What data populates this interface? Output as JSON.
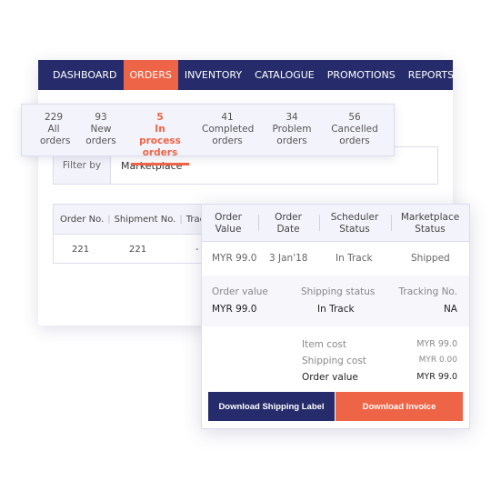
{
  "nav": {
    "items": [
      {
        "label": "DASHBOARD",
        "active": false
      },
      {
        "label": "ORDERS",
        "active": true
      },
      {
        "label": "INVENTORY",
        "active": false
      },
      {
        "label": "CATALOGUE",
        "active": false
      },
      {
        "label": "PROMOTIONS",
        "active": false
      },
      {
        "label": "REPORTS",
        "active": false
      }
    ]
  },
  "stats": [
    {
      "count": "229",
      "line1": "All",
      "line2": "orders"
    },
    {
      "count": "93",
      "line1": "New",
      "line2": "orders"
    },
    {
      "count": "5",
      "line1": "In process",
      "line2": "orders"
    },
    {
      "count": "41",
      "line1": "Completed",
      "line2": "orders"
    },
    {
      "count": "34",
      "line1": "Problem",
      "line2": "orders"
    },
    {
      "count": "56",
      "line1": "Cancelled",
      "line2": "orders"
    }
  ],
  "filter": {
    "label": "Filter by",
    "value": "Marketplace"
  },
  "table": {
    "headers": [
      "Order No.",
      "Shipment No.",
      "Trac"
    ],
    "rows": [
      {
        "order_no": "221",
        "shipment_no": "221",
        "tracking": "-"
      }
    ]
  },
  "popup": {
    "headers": [
      {
        "l1": "Order",
        "l2": "Value"
      },
      {
        "l1": "Order",
        "l2": "Date"
      },
      {
        "l1": "Scheduler",
        "l2": "Status"
      },
      {
        "l1": "Marketplace",
        "l2": "Status"
      }
    ],
    "row": {
      "order_value": "MYR 99.0",
      "order_date": "3 Jan'18",
      "scheduler_status": "In Track",
      "marketplace_status": "Shipped"
    },
    "details": {
      "order_value_label": "Order value",
      "order_value": "MYR 99.0",
      "shipping_status_label": "Shipping status",
      "shipping_status": "In Track",
      "tracking_label": "Tracking No.",
      "tracking": "NA"
    },
    "costs": {
      "item_cost_label": "Item cost",
      "item_cost": "MYR 99.0",
      "shipping_cost_label": "Shipping cost",
      "shipping_cost": "MYR 0.00",
      "order_value_label": "Order value",
      "order_value": "MYR 99.0"
    },
    "buttons": {
      "shipping_label": "Download Shipping Label",
      "invoice": "Download Invoice"
    }
  },
  "colors": {
    "navy": "#262c6b",
    "accent": "#ee6446"
  }
}
